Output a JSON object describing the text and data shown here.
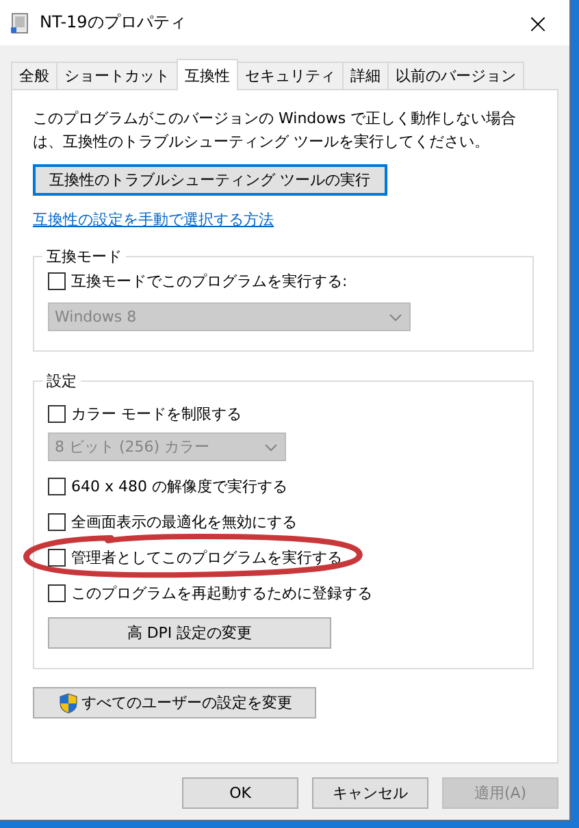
{
  "window": {
    "title": "NT-19のプロパティ",
    "close": "×"
  },
  "tabs": [
    {
      "label": "全般",
      "selected": false
    },
    {
      "label": "ショートカット",
      "selected": false
    },
    {
      "label": "互換性",
      "selected": true
    },
    {
      "label": "セキュリティ",
      "selected": false
    },
    {
      "label": "詳細",
      "selected": false
    },
    {
      "label": "以前のバージョン",
      "selected": false
    }
  ],
  "intro": "このプログラムがこのバージョンの Windows で正しく動作しない場合は、互換性のトラブルシューティング ツールを実行してください。",
  "troubleshoot_button": {
    "label": "互換性のトラブルシューティング ツールの実行",
    "focused": true
  },
  "manual_link": "互換性の設定を手動で選択する方法",
  "compat_mode": {
    "label": "互換モード",
    "checkbox": {
      "label": "互換モードでこのプログラムを実行する:",
      "checked": false
    },
    "dropdown": {
      "value": "Windows 8",
      "disabled": true
    }
  },
  "settings": {
    "label": "設定",
    "items": [
      {
        "kind": "checkbox",
        "label": "カラー モードを制限する",
        "checked": false
      },
      {
        "kind": "dropdown",
        "value": "8 ビット (256) カラー",
        "disabled": true
      },
      {
        "kind": "checkbox",
        "label": "640 x 480 の解像度で実行する",
        "checked": false
      },
      {
        "kind": "checkbox",
        "label": "全画面表示の最適化を無効にする",
        "checked": false
      },
      {
        "kind": "checkbox",
        "label": "管理者としてこのプログラムを実行する",
        "checked": false,
        "circled": true
      },
      {
        "kind": "checkbox",
        "label": "このプログラムを再起動するために登録する",
        "checked": false
      },
      {
        "kind": "button",
        "label": "高 DPI 設定の変更"
      }
    ]
  },
  "all_users_button": {
    "label": "すべてのユーザーの設定を変更"
  },
  "buttons": [
    {
      "label": "OK",
      "disabled": false
    },
    {
      "label": "キャンセル",
      "disabled": false
    },
    {
      "label": "適用(A)",
      "disabled": true
    }
  ]
}
